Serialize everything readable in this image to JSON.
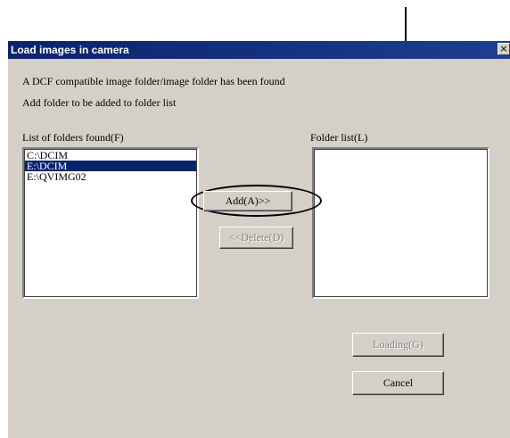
{
  "dialog": {
    "title": "Load images in camera",
    "close_glyph": "×",
    "message_line1": "A DCF compatible image folder/image folder has been found",
    "message_line2": "Add folder to be added to folder list"
  },
  "found_list": {
    "label": "List of folders found(F)",
    "items": [
      {
        "label": "C:\\DCIM",
        "selected": false
      },
      {
        "label": "E:\\DCIM",
        "selected": true
      },
      {
        "label": "E:\\QVIMG02",
        "selected": false
      }
    ]
  },
  "folder_list": {
    "label": "Folder list(L)",
    "items": []
  },
  "buttons": {
    "add_label": "Add(A)>>",
    "delete_label": "<<Delete(D)",
    "loading_label": "Loading(G)",
    "cancel_label": "Cancel"
  },
  "colors": {
    "title_bar": "#0a246a",
    "selection": "#0a246a",
    "dialog_face": "#d4d0c8"
  }
}
